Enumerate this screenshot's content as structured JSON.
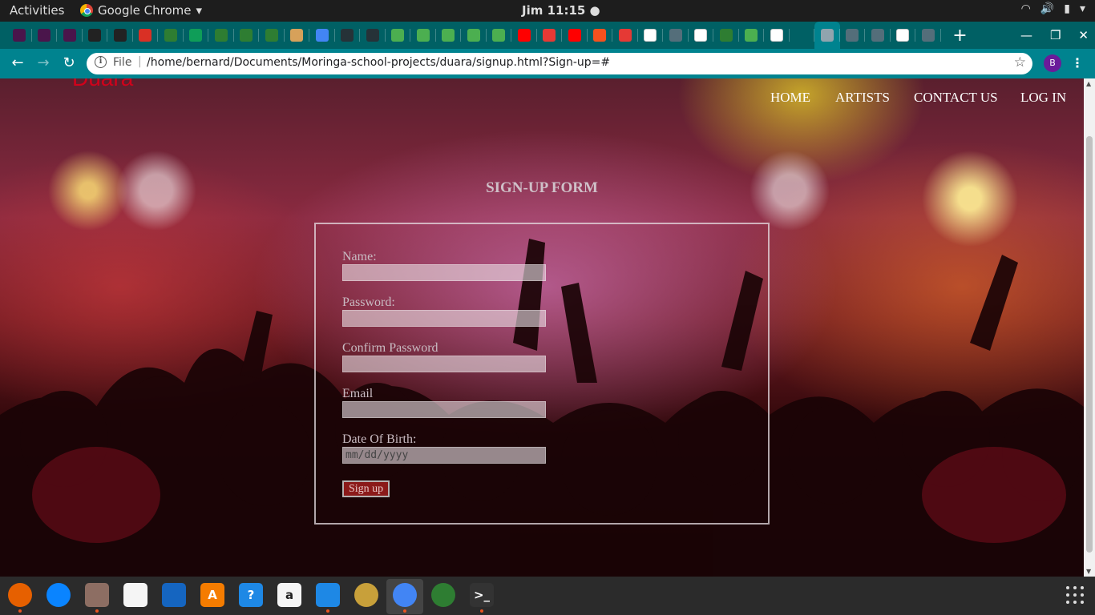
{
  "system": {
    "activities": "Activities",
    "app_name": "Google Chrome",
    "app_menu_arrow": "▾",
    "clock": "Jim 11:15 ●",
    "tray": [
      "wifi-icon",
      "volume-icon",
      "battery-icon",
      "power-menu-icon"
    ]
  },
  "tabs": {
    "favicons": [
      {
        "name": "slack",
        "color": "#4a154b"
      },
      {
        "name": "slack",
        "color": "#4a154b"
      },
      {
        "name": "slack",
        "color": "#4a154b"
      },
      {
        "name": "github",
        "color": "#222222"
      },
      {
        "name": "github",
        "color": "#222222"
      },
      {
        "name": "gmail",
        "color": "#d93025"
      },
      {
        "name": "palm",
        "color": "#2e7d32"
      },
      {
        "name": "sheets",
        "color": "#0f9d58"
      },
      {
        "name": "palm",
        "color": "#2e7d32"
      },
      {
        "name": "palm",
        "color": "#2e7d32"
      },
      {
        "name": "palm",
        "color": "#2e7d32"
      },
      {
        "name": "cookie",
        "color": "#d7a15a"
      },
      {
        "name": "docs",
        "color": "#4285f4"
      },
      {
        "name": "bird",
        "color": "#263238"
      },
      {
        "name": "bird",
        "color": "#263238"
      },
      {
        "name": "w3",
        "color": "#4caf50"
      },
      {
        "name": "w3",
        "color": "#4caf50"
      },
      {
        "name": "w3",
        "color": "#4caf50"
      },
      {
        "name": "w3",
        "color": "#4caf50"
      },
      {
        "name": "w3",
        "color": "#4caf50"
      },
      {
        "name": "youtube",
        "color": "#ff0000"
      },
      {
        "name": "chart",
        "color": "#e53935"
      },
      {
        "name": "youtube",
        "color": "#ff0000"
      },
      {
        "name": "x-mark",
        "color": "#f4511e"
      },
      {
        "name": "f",
        "color": "#e53935"
      },
      {
        "name": "doc-red",
        "color": "#ffffff"
      },
      {
        "name": "gear",
        "color": "#546e7a"
      },
      {
        "name": "google",
        "color": "#ffffff"
      },
      {
        "name": "android",
        "color": "#2e7d32"
      },
      {
        "name": "w3",
        "color": "#4caf50"
      },
      {
        "name": "google",
        "color": "#ffffff"
      },
      {
        "name": "download",
        "color": "#006064"
      },
      {
        "name": "close-circle",
        "color": "#90a4ae"
      },
      {
        "name": "globe",
        "color": "#546e7a"
      },
      {
        "name": "globe",
        "color": "#546e7a"
      },
      {
        "name": "google",
        "color": "#ffffff"
      },
      {
        "name": "globe",
        "color": "#546e7a"
      }
    ],
    "active_index": 32,
    "new_tab": "+"
  },
  "toolbar": {
    "scheme": "File",
    "separator": "|",
    "url": "/home/bernard/Documents/Moringa-school-projects/duara/signup.html?Sign-up=#",
    "avatar_letter": "B"
  },
  "page": {
    "brand": "Duara",
    "nav": [
      "HOME",
      "ARTISTS",
      "CONTACT US",
      "LOG IN"
    ],
    "form_title": "SIGN-UP FORM",
    "fields": [
      {
        "label": "Name:",
        "value": ""
      },
      {
        "label": "Password:",
        "value": ""
      },
      {
        "label": "Confirm Password",
        "value": ""
      },
      {
        "label": "Email",
        "value": ""
      },
      {
        "label": "Date Of Birth:",
        "value": "mm/dd/yyyy"
      }
    ],
    "submit_label": "Sign up"
  },
  "dock": [
    {
      "name": "firefox",
      "color": "#e66000",
      "glyph": "",
      "running": true
    },
    {
      "name": "thunderbird",
      "color": "#0a84ff",
      "glyph": "",
      "running": false
    },
    {
      "name": "files",
      "color": "#8d6e63",
      "glyph": "",
      "running": true
    },
    {
      "name": "rhythmbox",
      "color": "#f5f5f5",
      "glyph": "",
      "running": false
    },
    {
      "name": "libreoffice-writer",
      "color": "#1565c0",
      "glyph": "",
      "running": false
    },
    {
      "name": "software-center",
      "color": "#f57c00",
      "glyph": "A",
      "running": false
    },
    {
      "name": "help",
      "color": "#1e88e5",
      "glyph": "?",
      "running": false
    },
    {
      "name": "amazon",
      "color": "#f5f5f5",
      "glyph": "a",
      "running": false
    },
    {
      "name": "vscode",
      "color": "#1e88e5",
      "glyph": "",
      "running": true
    },
    {
      "name": "speaker-app",
      "color": "#c8a03a",
      "glyph": "",
      "running": false
    },
    {
      "name": "chrome",
      "color": "#4285f4",
      "glyph": "",
      "running": true
    },
    {
      "name": "atom",
      "color": "#2e7d32",
      "glyph": "",
      "running": false
    },
    {
      "name": "terminal",
      "color": "#333333",
      "glyph": ">_",
      "running": true
    }
  ]
}
